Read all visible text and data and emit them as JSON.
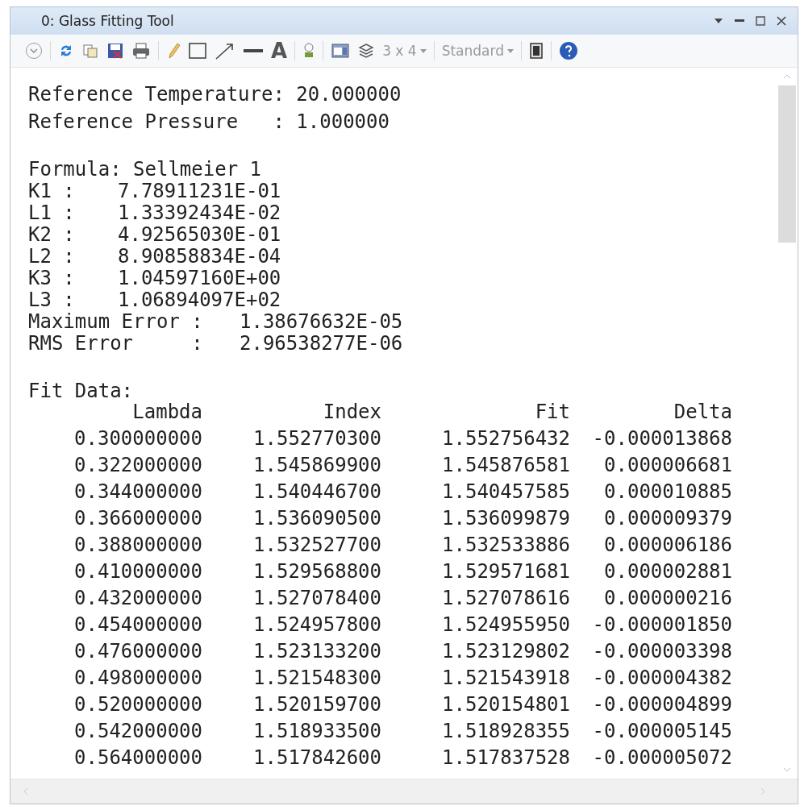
{
  "window": {
    "title": "0: Glass Fitting Tool"
  },
  "toolbar": {
    "text_tool": "A",
    "layout": "3 x 4",
    "style": "Standard"
  },
  "report": {
    "reference": [
      "Reference Temperature: 20.000000",
      "Reference Pressure   : 1.000000"
    ],
    "formula": "Formula: Sellmeier 1",
    "coefficients": [
      {
        "label": "K1 :",
        "value": "7.78911231E-01"
      },
      {
        "label": "L1 :",
        "value": "1.33392434E-02"
      },
      {
        "label": "K2 :",
        "value": "4.92565030E-01"
      },
      {
        "label": "L2 :",
        "value": "8.90858834E-04"
      },
      {
        "label": "K3 :",
        "value": "1.04597160E+00"
      },
      {
        "label": "L3 :",
        "value": "1.06894097E+02"
      }
    ],
    "errors": [
      {
        "label": "Maximum Error :",
        "value": "1.38676632E-05"
      },
      {
        "label": "RMS Error     :",
        "value": "2.96538277E-06"
      }
    ],
    "fit_title": "Fit Data:",
    "columns": [
      "Lambda",
      "Index",
      "Fit",
      "Delta"
    ],
    "rows": [
      [
        "0.300000000",
        "1.552770300",
        "1.552756432",
        "-0.000013868"
      ],
      [
        "0.322000000",
        "1.545869900",
        "1.545876581",
        "0.000006681"
      ],
      [
        "0.344000000",
        "1.540446700",
        "1.540457585",
        "0.000010885"
      ],
      [
        "0.366000000",
        "1.536090500",
        "1.536099879",
        "0.000009379"
      ],
      [
        "0.388000000",
        "1.532527700",
        "1.532533886",
        "0.000006186"
      ],
      [
        "0.410000000",
        "1.529568800",
        "1.529571681",
        "0.000002881"
      ],
      [
        "0.432000000",
        "1.527078400",
        "1.527078616",
        "0.000000216"
      ],
      [
        "0.454000000",
        "1.524957800",
        "1.524955950",
        "-0.000001850"
      ],
      [
        "0.476000000",
        "1.523133200",
        "1.523129802",
        "-0.000003398"
      ],
      [
        "0.498000000",
        "1.521548300",
        "1.521543918",
        "-0.000004382"
      ],
      [
        "0.520000000",
        "1.520159700",
        "1.520154801",
        "-0.000004899"
      ],
      [
        "0.542000000",
        "1.518933500",
        "1.518928355",
        "-0.000005145"
      ],
      [
        "0.564000000",
        "1.517842600",
        "1.517837528",
        "-0.000005072"
      ]
    ]
  }
}
